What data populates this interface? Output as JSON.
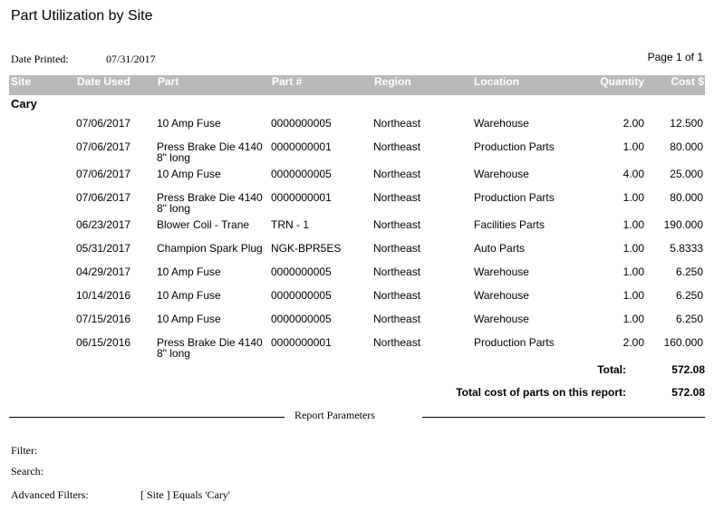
{
  "report": {
    "title": "Part Utilization by Site",
    "date_printed_label": "Date Printed:",
    "date_printed_value": "07/31/2017",
    "page_label": "Page 1 of 1"
  },
  "columns": {
    "site": "Site",
    "date_used": "Date Used",
    "part": "Part",
    "part_no": "Part #",
    "region": "Region",
    "location": "Location",
    "quantity": "Quantity",
    "cost": "Cost $"
  },
  "group": {
    "site": "Cary",
    "rows": [
      {
        "date": "07/06/2017",
        "part": "10 Amp Fuse",
        "part_no": "0000000005",
        "region": "Northeast",
        "location": "Warehouse",
        "quantity": "2.00",
        "cost": "12.500"
      },
      {
        "date": "07/06/2017",
        "part": "Press Brake Die 4140 8\" long",
        "part_no": "0000000001",
        "region": "Northeast",
        "location": "Production Parts",
        "quantity": "1.00",
        "cost": "80.000"
      },
      {
        "date": "07/06/2017",
        "part": "10 Amp Fuse",
        "part_no": "0000000005",
        "region": "Northeast",
        "location": "Warehouse",
        "quantity": "4.00",
        "cost": "25.000"
      },
      {
        "date": "07/06/2017",
        "part": "Press Brake Die 4140 8\" long",
        "part_no": "0000000001",
        "region": "Northeast",
        "location": "Production Parts",
        "quantity": "1.00",
        "cost": "80.000"
      },
      {
        "date": "06/23/2017",
        "part": "Blower Coil - Trane",
        "part_no": "TRN - 1",
        "region": "Northeast",
        "location": "Facilities Parts",
        "quantity": "1.00",
        "cost": "190.000"
      },
      {
        "date": "05/31/2017",
        "part": "Champion Spark Plug",
        "part_no": "NGK-BPR5ES",
        "region": "Northeast",
        "location": "Auto Parts",
        "quantity": "1.00",
        "cost": "5.8333"
      },
      {
        "date": "04/29/2017",
        "part": "10 Amp Fuse",
        "part_no": "0000000005",
        "region": "Northeast",
        "location": "Warehouse",
        "quantity": "1.00",
        "cost": "6.250"
      },
      {
        "date": "10/14/2016",
        "part": "10 Amp Fuse",
        "part_no": "0000000005",
        "region": "Northeast",
        "location": "Warehouse",
        "quantity": "1.00",
        "cost": "6.250"
      },
      {
        "date": "07/15/2016",
        "part": "10 Amp Fuse",
        "part_no": "0000000005",
        "region": "Northeast",
        "location": "Warehouse",
        "quantity": "1.00",
        "cost": "6.250"
      },
      {
        "date": "06/15/2016",
        "part": "Press Brake Die 4140 8\" long",
        "part_no": "0000000001",
        "region": "Northeast",
        "location": "Production Parts",
        "quantity": "2.00",
        "cost": "160.000"
      }
    ],
    "total_label": "Total:",
    "total_value": "572.08"
  },
  "grand_total": {
    "label": "Total cost of parts on this report:",
    "value": "572.08"
  },
  "parameters": {
    "title": "Report Parameters",
    "filter_label": "Filter:",
    "filter_value": "",
    "search_label": "Search:",
    "search_value": "",
    "advanced_label": "Advanced Filters:",
    "advanced_value": "[ Site ] Equals 'Cary'"
  },
  "colors": {
    "header_bar": "#b9b9b9",
    "header_text": "#ffffff"
  }
}
